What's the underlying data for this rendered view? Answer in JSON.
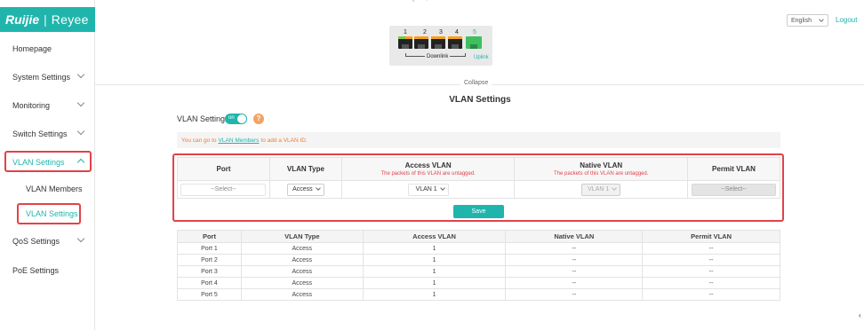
{
  "brand": {
    "name": "Ruijie",
    "divider": "|",
    "sub": "Reyee"
  },
  "sidebar": {
    "items": [
      {
        "label": "Homepage"
      },
      {
        "label": "System Settings"
      },
      {
        "label": "Monitoring"
      },
      {
        "label": "Switch Settings"
      },
      {
        "label": "VLAN Settings"
      },
      {
        "label": "QoS Settings"
      },
      {
        "label": "PoE Settings"
      }
    ],
    "sub_items": [
      {
        "label": "VLAN Members"
      },
      {
        "label": "VLAN Settings"
      }
    ]
  },
  "header": {
    "language": "English",
    "logout": "Logout"
  },
  "device": {
    "ports": [
      "1",
      "2",
      "3",
      "4",
      "5"
    ],
    "downlink_label": "Downlink",
    "uplink_label": "Uplink"
  },
  "collapse_label": "Collapse",
  "page_title": "VLAN Settings",
  "vlan_toggle": {
    "label": "VLAN Settings",
    "state": "on",
    "help": "?"
  },
  "notice": {
    "prefix": "You can go to",
    "link": "VLAN Members",
    "suffix": "to add a VLAN ID."
  },
  "config_table": {
    "headers": {
      "port": "Port",
      "vlan_type": "VLAN Type",
      "access_vlan": "Access VLAN",
      "access_vlan_sub": "The packets of this VLAN are untagged.",
      "native_vlan": "Native VLAN",
      "native_vlan_sub": "The packets of this VLAN are untagged.",
      "permit_vlan": "Permit VLAN"
    },
    "row": {
      "port": "--Select--",
      "vlan_type": "Access",
      "access_vlan": "VLAN 1",
      "native_vlan": "VLAN 1",
      "permit_vlan": "--Select--"
    },
    "save_label": "Save"
  },
  "status_table": {
    "headers": [
      "Port",
      "VLAN Type",
      "Access VLAN",
      "Native VLAN",
      "Permit VLAN"
    ],
    "rows": [
      [
        "Port 1",
        "Access",
        "1",
        "--",
        "--"
      ],
      [
        "Port 2",
        "Access",
        "1",
        "--",
        "--"
      ],
      [
        "Port 3",
        "Access",
        "1",
        "--",
        "--"
      ],
      [
        "Port 4",
        "Access",
        "1",
        "--",
        "--"
      ],
      [
        "Port 5",
        "Access",
        "1",
        "--",
        "--"
      ]
    ]
  },
  "colors": {
    "accent": "#1fb5ac",
    "highlight": "#e2424a",
    "warning": "#ef7b36",
    "help": "#f4a261"
  }
}
